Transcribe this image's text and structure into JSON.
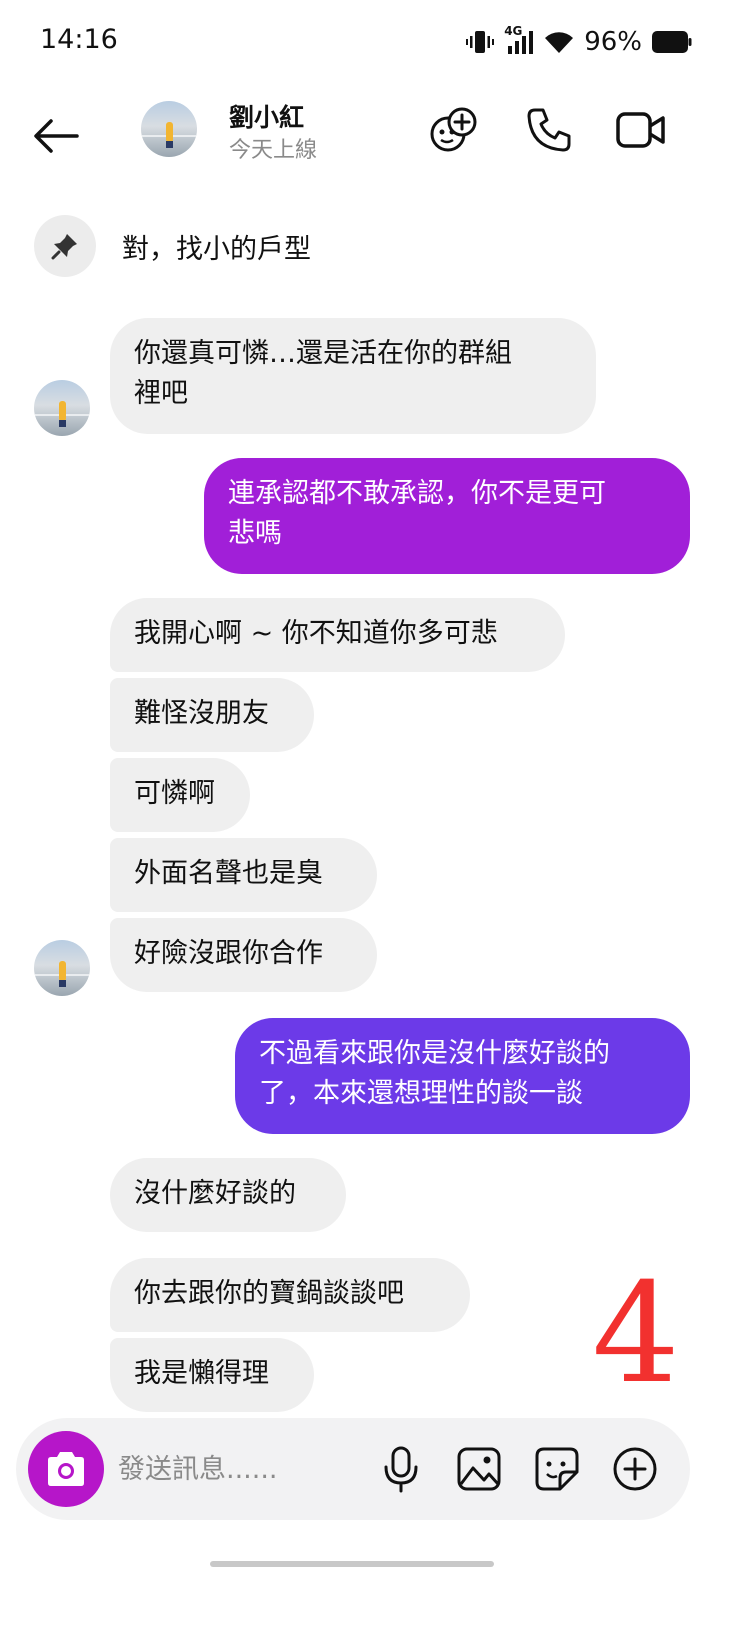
{
  "status_bar": {
    "time": "14:16",
    "network": "4G",
    "battery": "96%"
  },
  "header": {
    "contact_name": "劉小紅",
    "contact_status": "今天上線"
  },
  "pinned": {
    "text": "對，找小的戶型"
  },
  "messages": [
    {
      "side": "received",
      "text": "你還真可憐…還是活在你的群組\n裡吧"
    },
    {
      "side": "sent",
      "text": "連承認都不敢承認，你不是更可\n悲嗎"
    },
    {
      "side": "received",
      "text": "我開心啊 ~ 你不知道你多可悲"
    },
    {
      "side": "received",
      "text": "難怪沒朋友"
    },
    {
      "side": "received",
      "text": "可憐啊"
    },
    {
      "side": "received",
      "text": "外面名聲也是臭"
    },
    {
      "side": "received",
      "text": "好險沒跟你合作"
    },
    {
      "side": "sent",
      "text": "不過看來跟你是沒什麼好談的\n了，本來還想理性的談一談"
    },
    {
      "side": "received",
      "text": "沒什麼好談的"
    },
    {
      "side": "received",
      "text": "你去跟你的寶鍋談談吧"
    },
    {
      "side": "received",
      "text": "我是懶得理"
    }
  ],
  "overlay_number": "4",
  "composer": {
    "placeholder": "發送訊息......"
  },
  "colors": {
    "sent_bubble_1": "#a11fd8",
    "sent_bubble_2": "#6c3ae8",
    "received_bubble": "#efefef",
    "camera_button": "#b616c9",
    "overlay_number": "#f2312f"
  },
  "icons": [
    "back-arrow-icon",
    "add-person-icon",
    "phone-icon",
    "video-camera-icon",
    "pin-icon",
    "camera-icon",
    "microphone-icon",
    "gallery-icon",
    "sticker-icon",
    "plus-circle-icon"
  ]
}
